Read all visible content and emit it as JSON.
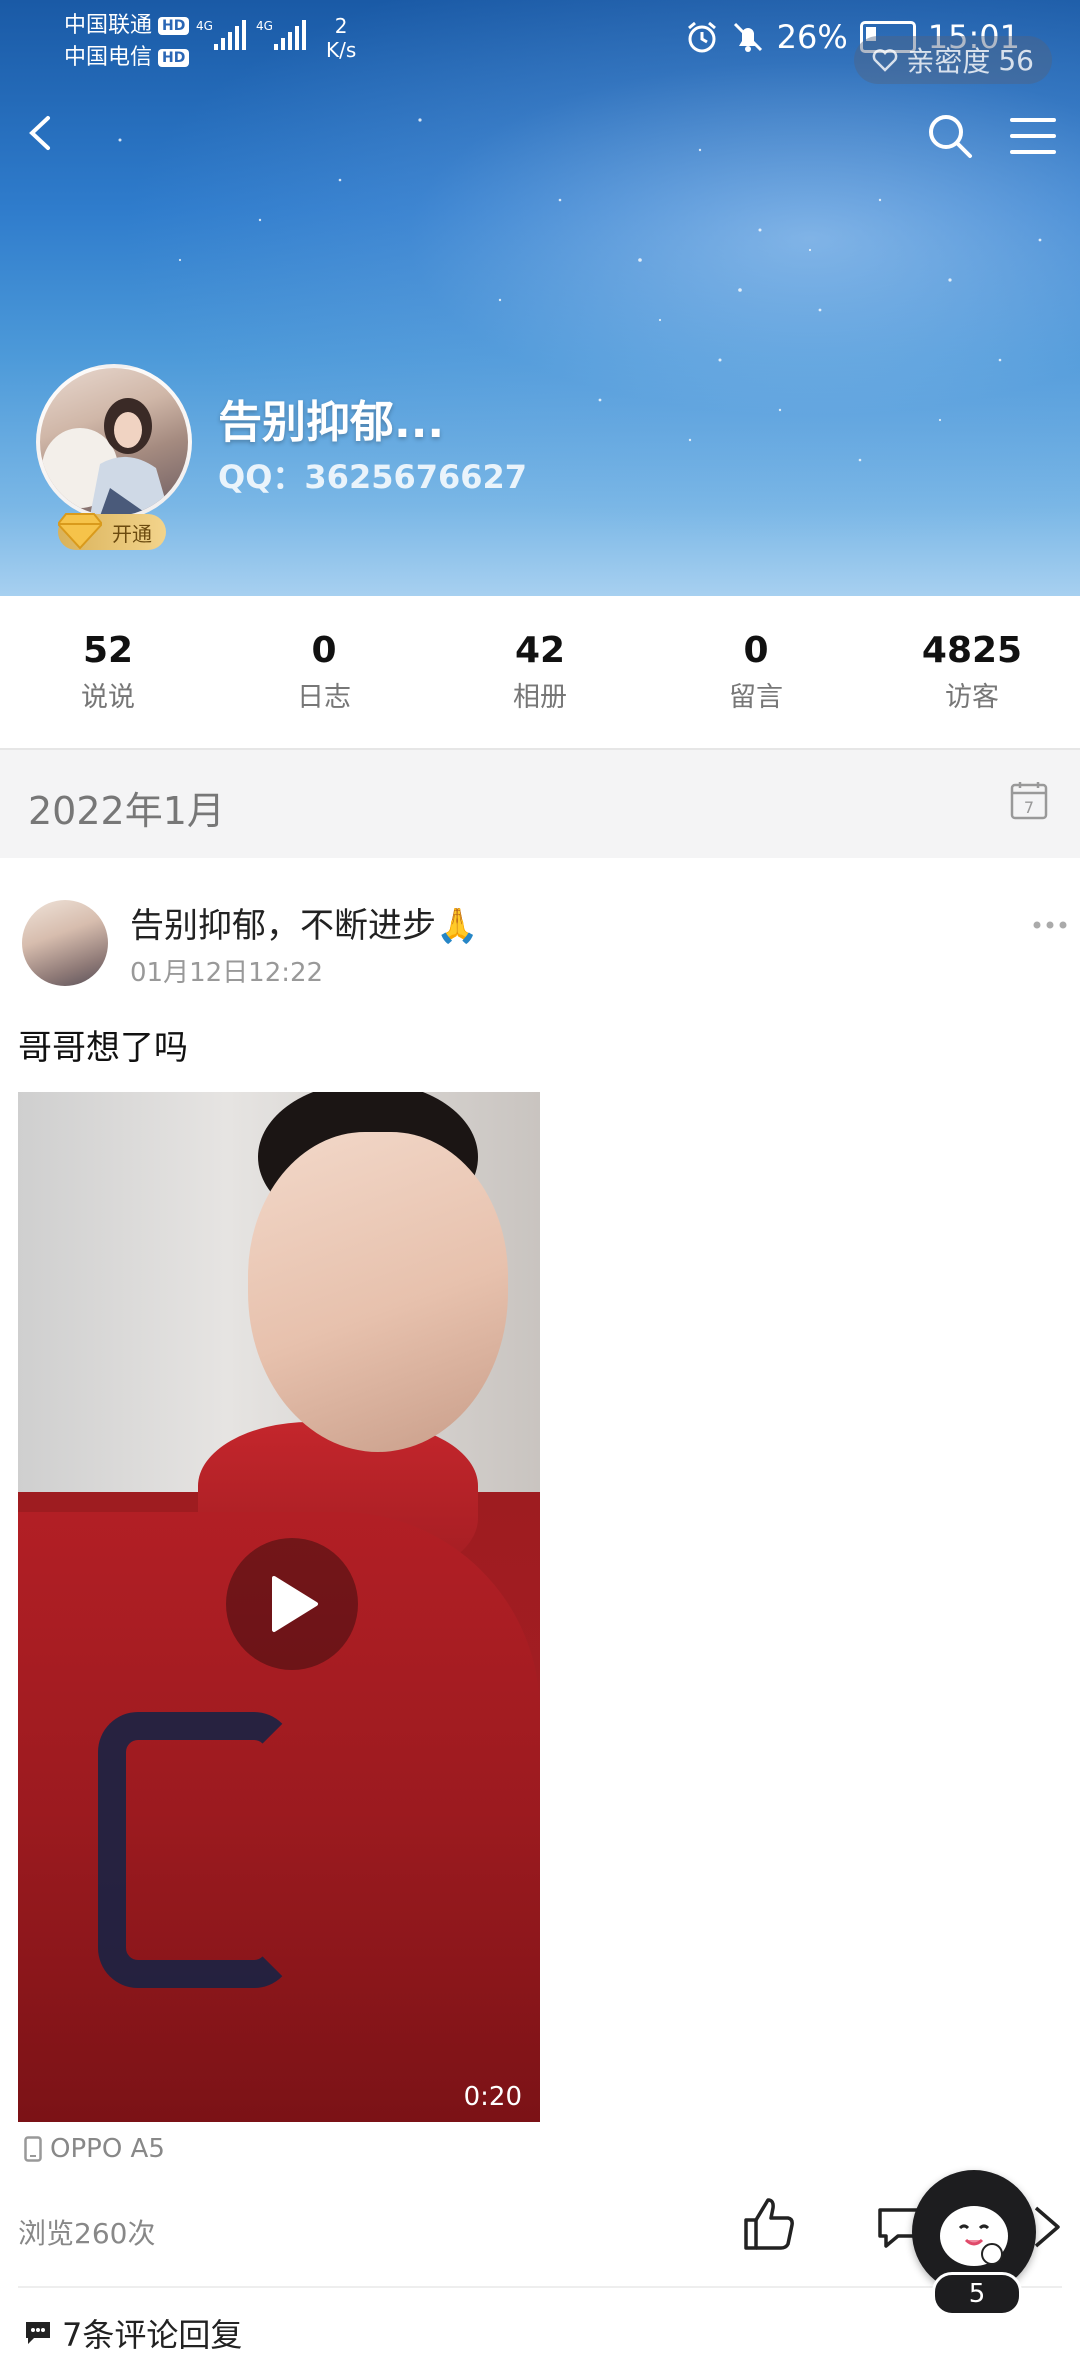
{
  "status_bar": {
    "carrier1": "中国联通",
    "carrier2": "中国电信",
    "hd": "HD",
    "net1": "4G",
    "net2": "4G",
    "speed_value": "2",
    "speed_unit": "K/s",
    "battery": "26%",
    "time": "15:01"
  },
  "header": {
    "intimacy_label": "亲密度",
    "intimacy_value": "56",
    "profile_name": "告别抑郁...",
    "qq": "QQ：3625676627",
    "vip_label": "开通"
  },
  "stats": [
    {
      "value": "52",
      "label": "说说"
    },
    {
      "value": "0",
      "label": "日志"
    },
    {
      "value": "42",
      "label": "相册"
    },
    {
      "value": "0",
      "label": "留言"
    },
    {
      "value": "4825",
      "label": "访客"
    }
  ],
  "month": {
    "label": "2022年1月",
    "calendar_day": "7"
  },
  "post": {
    "author": "告别抑郁，不断进步🙏",
    "time": "01月12日12:22",
    "text": "哥哥想了吗",
    "video_duration": "0:20",
    "device": "OPPO A5",
    "views": "浏览260次",
    "comments": "7条评论回复"
  },
  "floating": {
    "badge": "5"
  },
  "icons": [
    "back-icon",
    "search-icon",
    "menu-icon",
    "calendar-icon",
    "more-icon",
    "play-icon",
    "phone-icon",
    "like-icon",
    "comment-icon",
    "share-icon",
    "chat-bubble-icon",
    "assistant-icon"
  ]
}
